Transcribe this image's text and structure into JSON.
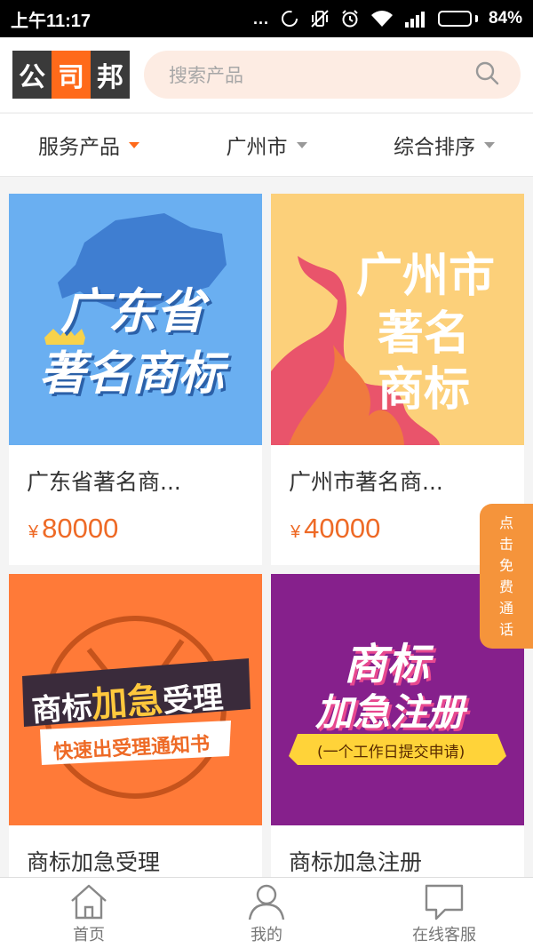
{
  "status_bar": {
    "time": "上午11:17",
    "dots": "...",
    "battery_percent_text": "84%",
    "battery_level": 0.84
  },
  "header": {
    "logo": [
      "公",
      "司",
      "邦"
    ],
    "search_placeholder": "搜索产品"
  },
  "filters": [
    {
      "label": "服务产品",
      "active": true
    },
    {
      "label": "广州市",
      "active": false
    },
    {
      "label": "综合排序",
      "active": false
    }
  ],
  "products": [
    {
      "title": "广东省著名商...",
      "price": "80000",
      "currency": "¥",
      "image": {
        "bg": "#6aaff1",
        "lines": [
          "广东省",
          "著名商标"
        ]
      }
    },
    {
      "title": "广州市著名商...",
      "price": "40000",
      "currency": "¥",
      "image": {
        "bg": "#fcd07a",
        "lines": [
          "广州市",
          "著名",
          "商标"
        ]
      }
    },
    {
      "title": "商标加急受理",
      "image": {
        "bg": "#ff7a38",
        "lines": [
          "商标",
          "加急",
          "受理",
          "快速出受理通知书"
        ]
      }
    },
    {
      "title": "商标加急注册",
      "image": {
        "bg": "#86208c",
        "lines": [
          "商标",
          "加急注册",
          "(一个工作日提交申请)"
        ]
      }
    }
  ],
  "float_call": [
    "点",
    "击",
    "免",
    "费",
    "通",
    "话"
  ],
  "bottom_nav": [
    {
      "label": "首页",
      "icon": "home-icon"
    },
    {
      "label": "我的",
      "icon": "user-icon"
    },
    {
      "label": "在线客服",
      "icon": "chat-icon"
    }
  ],
  "colors": {
    "accent": "#ff6a1a",
    "price": "#ee6a26",
    "search_bg": "#fdece3",
    "float_btn": "#f5943b"
  }
}
